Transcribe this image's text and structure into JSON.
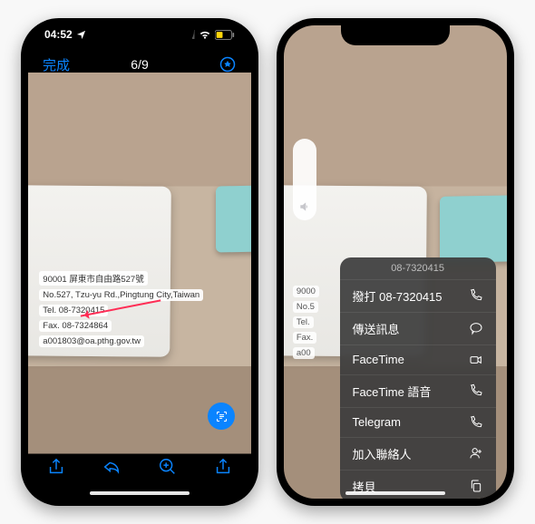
{
  "left": {
    "status_time": "04:52",
    "done": "完成",
    "counter": "6/9",
    "card": {
      "line1": "90001 屏東市自由路527號",
      "line2": "No.527, Tzu-yu Rd.,Pingtung City,Taiwan",
      "line3": "Tel.  08-7320415",
      "line4": "Fax. 08-7324864",
      "line5": "a001803@oa.pthg.gov.tw"
    }
  },
  "right": {
    "truncated": {
      "a": "9000",
      "b": "No.5",
      "c": "Tel.",
      "d": "Fax.",
      "e": "a00"
    },
    "menu": {
      "header": "08-7320415",
      "call": "撥打 08-7320415",
      "message": "傳送訊息",
      "facetime": "FaceTime",
      "facetime_audio": "FaceTime 語音",
      "telegram": "Telegram",
      "add_contact": "加入聯絡人",
      "copy": "拷貝"
    }
  }
}
